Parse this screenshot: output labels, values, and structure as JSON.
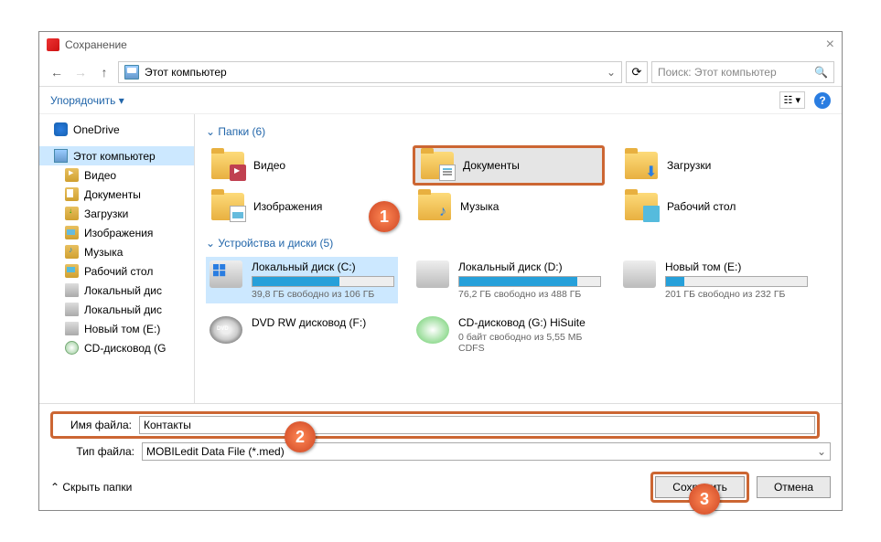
{
  "title": "Сохранение",
  "breadcrumb": "Этот компьютер",
  "search_placeholder": "Поиск: Этот компьютер",
  "toolbar": {
    "organize": "Упорядочить"
  },
  "sidebar": {
    "onedrive": "OneDrive",
    "this_pc": "Этот компьютер",
    "items": [
      {
        "label": "Видео",
        "icon": "ic-video"
      },
      {
        "label": "Документы",
        "icon": "ic-docs"
      },
      {
        "label": "Загрузки",
        "icon": "ic-down"
      },
      {
        "label": "Изображения",
        "icon": "ic-img"
      },
      {
        "label": "Музыка",
        "icon": "ic-music"
      },
      {
        "label": "Рабочий стол",
        "icon": "ic-desk"
      },
      {
        "label": "Локальный дис",
        "icon": "ic-drive"
      },
      {
        "label": "Локальный дис",
        "icon": "ic-drive"
      },
      {
        "label": "Новый том (Е:)",
        "icon": "ic-drive"
      },
      {
        "label": "CD-дисковод (G",
        "icon": "ic-cd"
      }
    ]
  },
  "content": {
    "folders_header": "Папки (6)",
    "folders": [
      {
        "label": "Видео",
        "ov": "ov-video"
      },
      {
        "label": "Документы",
        "ov": "ov-docs",
        "hl": true
      },
      {
        "label": "Загрузки",
        "ov": "ov-down"
      },
      {
        "label": "Изображения",
        "ov": "ov-img"
      },
      {
        "label": "Музыка",
        "ov": "ov-music"
      },
      {
        "label": "Рабочий стол",
        "ov": "ov-desk"
      }
    ],
    "drives_header": "Устройства и диски (5)",
    "drives": [
      {
        "name": "Локальный диск (C:)",
        "free": "39,8 ГБ свободно из 106 ГБ",
        "fill": 62,
        "icon": "di-win",
        "sel": true
      },
      {
        "name": "Локальный диск (D:)",
        "free": "76,2 ГБ свободно из 488 ГБ",
        "fill": 84,
        "icon": ""
      },
      {
        "name": "Новый том (E:)",
        "free": "201 ГБ свободно из 232 ГБ",
        "fill": 13,
        "icon": ""
      },
      {
        "name": "DVD RW дисковод (F:)",
        "free": "",
        "fill": -1,
        "icon": "di-dvd"
      },
      {
        "name": "CD-дисковод (G:) HiSuite",
        "free": "0 байт свободно из 5,55 МБ",
        "sub": "CDFS",
        "fill": -1,
        "icon": "di-cd"
      }
    ]
  },
  "footer": {
    "filename_label": "Имя файла:",
    "filename_value": "Контакты",
    "filetype_label": "Тип файла:",
    "filetype_value": "MOBILedit Data File (*.med)",
    "hide_folders": "Скрыть папки",
    "save": "Сохранить",
    "cancel": "Отмена"
  },
  "markers": {
    "m1": "1",
    "m2": "2",
    "m3": "3"
  }
}
